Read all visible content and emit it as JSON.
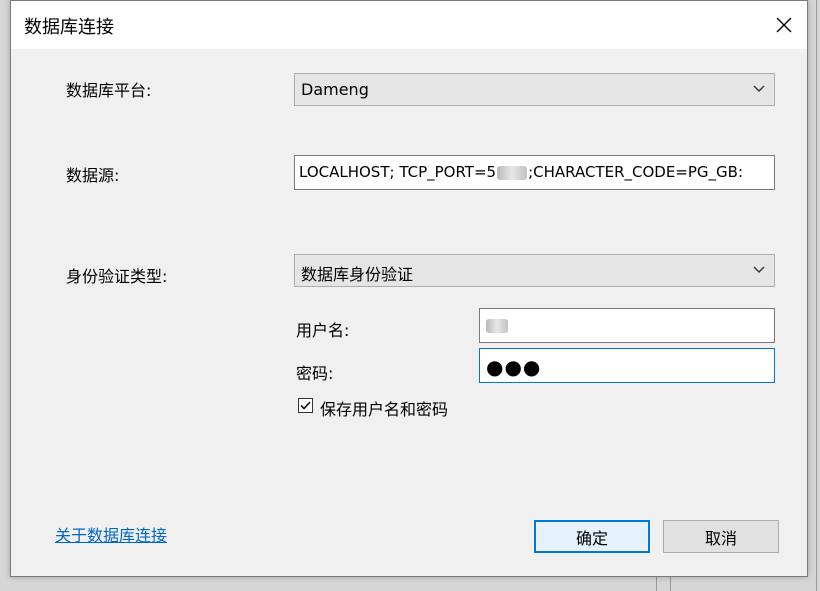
{
  "dialog": {
    "title": "数据库连接"
  },
  "platform": {
    "label": "数据库平台:",
    "value": "Dameng"
  },
  "datasource": {
    "label": "数据源:",
    "value_prefix": "LOCALHOST; TCP_PORT=5",
    "value_suffix": ";CHARACTER_CODE=PG_GB:"
  },
  "auth": {
    "label": "身份验证类型:",
    "value": "数据库身份验证"
  },
  "username": {
    "label": "用户名:"
  },
  "password": {
    "label": "密码:",
    "masked": "●●●"
  },
  "save_credentials": {
    "label": "保存用户名和密码",
    "checked": true
  },
  "footer": {
    "about_link": "关于数据库连接",
    "ok_label": "确定",
    "cancel_label": "取消"
  },
  "colors": {
    "accent": "#0078d7",
    "link": "#0066cc",
    "dialog_bg": "#f0f0f0"
  }
}
